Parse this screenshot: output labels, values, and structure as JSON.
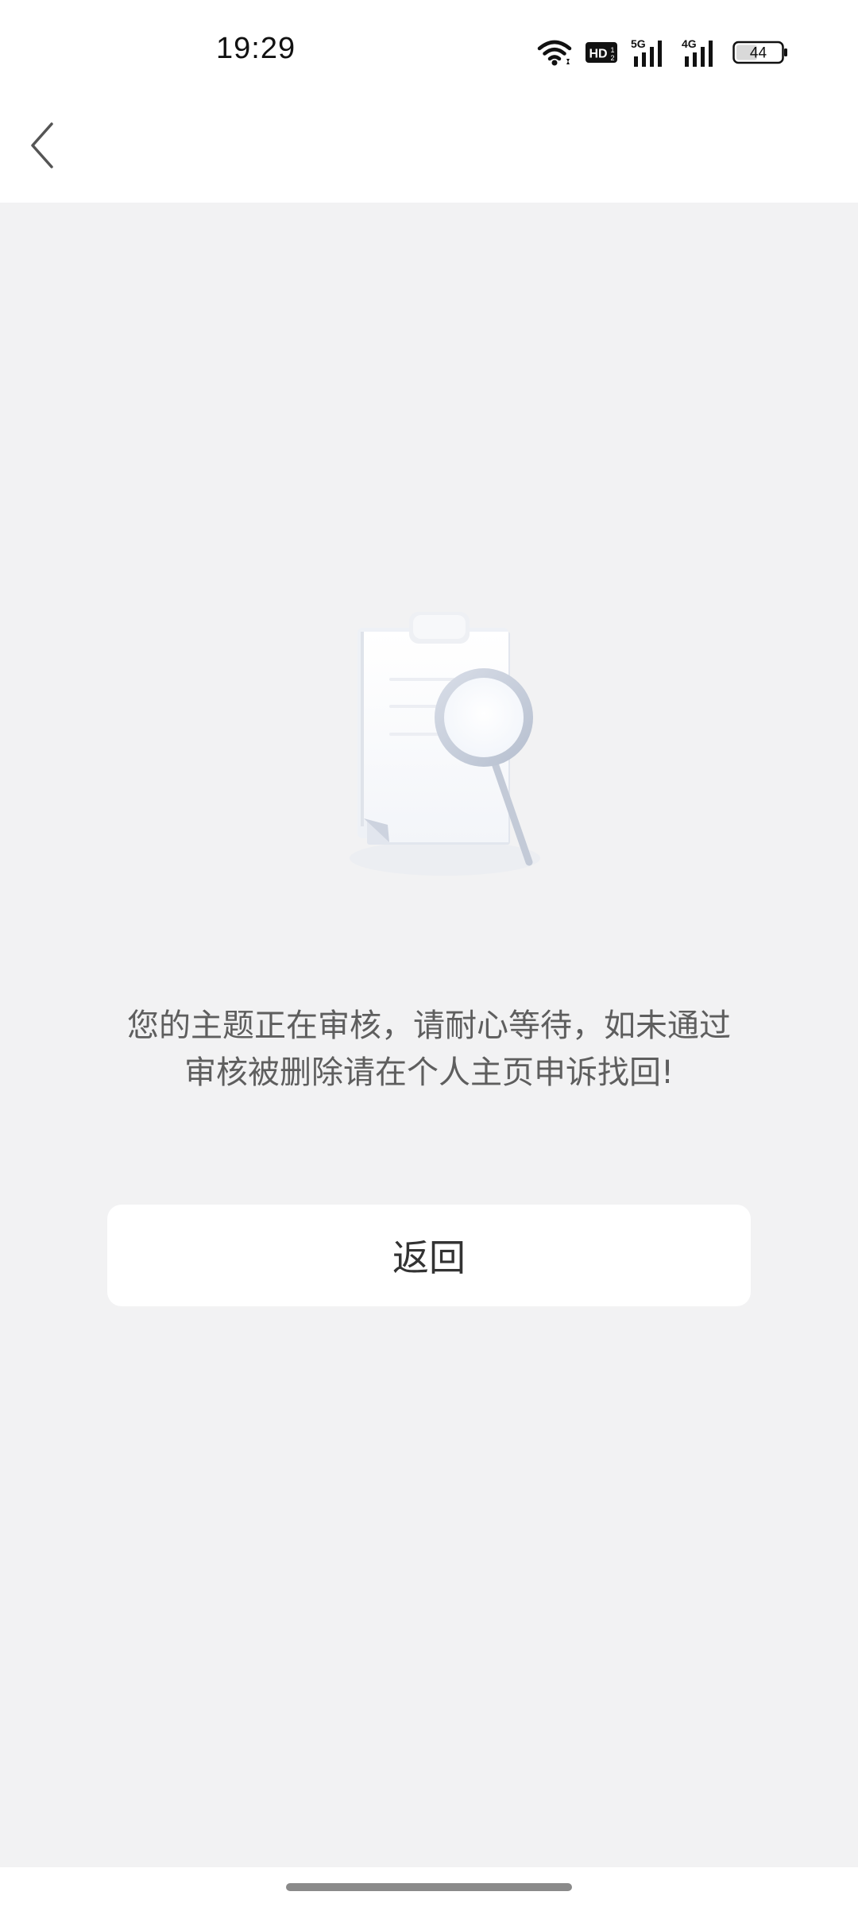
{
  "status_bar": {
    "time": "19:29",
    "network_labels": [
      "HD",
      "5G",
      "4G"
    ],
    "battery_level": "44",
    "icons": [
      "wifi-icon",
      "hd-icon",
      "signal-5g-icon",
      "signal-4g-icon",
      "battery-icon"
    ]
  },
  "nav": {
    "back_icon": "chevron-left-icon"
  },
  "illustration": {
    "icon": "document-search-icon"
  },
  "message": {
    "text": "您的主题正在审核，请耐心等待，如未通过审核被删除请在个人主页申诉找回!"
  },
  "actions": {
    "return_label": "返回"
  },
  "colors": {
    "background": "#f2f2f3",
    "surface": "#ffffff",
    "text_secondary": "#5e5e5e",
    "text_primary": "#333333"
  }
}
